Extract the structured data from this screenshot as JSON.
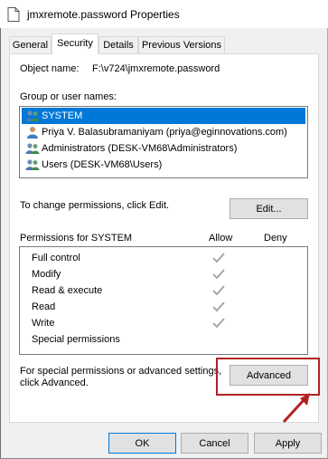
{
  "window": {
    "title": "jmxremote.password Properties",
    "icon": "document-icon"
  },
  "tabs": [
    {
      "label": "General",
      "active": false
    },
    {
      "label": "Security",
      "active": true
    },
    {
      "label": "Details",
      "active": false
    },
    {
      "label": "Previous Versions",
      "active": false
    }
  ],
  "object": {
    "label": "Object name:",
    "value": "F:\\v724\\jmxremote.password"
  },
  "groups": {
    "label": "Group or user names:",
    "items": [
      {
        "name": "SYSTEM",
        "selected": true,
        "icon": "users-group-icon"
      },
      {
        "name": "Priya V. Balasubramaniyam (priya@eginnovations.com)",
        "selected": false,
        "icon": "user-icon"
      },
      {
        "name": "Administrators (DESK-VM68\\Administrators)",
        "selected": false,
        "icon": "users-group-icon"
      },
      {
        "name": "Users (DESK-VM68\\Users)",
        "selected": false,
        "icon": "users-group-icon"
      }
    ]
  },
  "change_text": "To change permissions, click Edit.",
  "edit_label": "Edit...",
  "permissions": {
    "header": "Permissions for SYSTEM",
    "allow_header": "Allow",
    "deny_header": "Deny",
    "rows": [
      {
        "name": "Full control",
        "allow": true,
        "deny": false
      },
      {
        "name": "Modify",
        "allow": true,
        "deny": false
      },
      {
        "name": "Read & execute",
        "allow": true,
        "deny": false
      },
      {
        "name": "Read",
        "allow": true,
        "deny": false
      },
      {
        "name": "Write",
        "allow": true,
        "deny": false
      },
      {
        "name": "Special permissions",
        "allow": false,
        "deny": false
      }
    ]
  },
  "special": {
    "line1": "For special permissions or advanced settings,",
    "line2": "click Advanced.",
    "button": "Advanced"
  },
  "footer": {
    "ok": "OK",
    "cancel": "Cancel",
    "apply": "Apply"
  },
  "colors": {
    "selection": "#0078d7",
    "highlight": "#b22222",
    "check": "#a0a0a0"
  }
}
